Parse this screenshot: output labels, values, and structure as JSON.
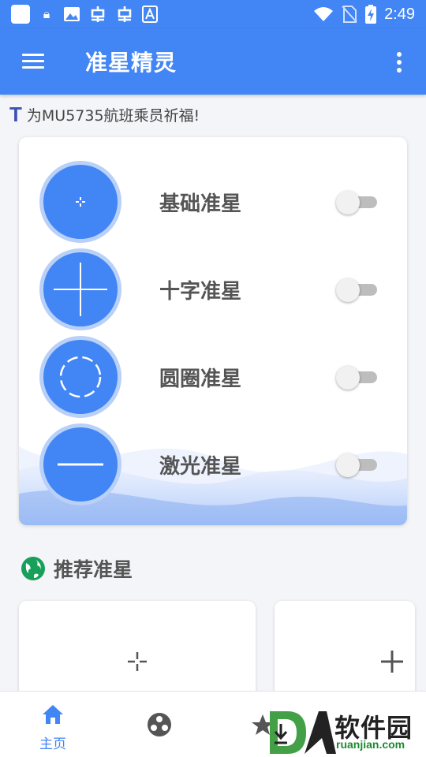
{
  "status_bar": {
    "time": "2:49",
    "left_icons": [
      "app-square-icon",
      "lock-icon",
      "image-icon",
      "bug-icon",
      "bug-icon",
      "font-icon"
    ],
    "right_icons": [
      "wifi-icon",
      "no-sim-icon",
      "battery-charging-icon"
    ]
  },
  "app_bar": {
    "title": "准星精灵"
  },
  "notice": {
    "text": "为MU5735航班乘员祈福!"
  },
  "crosshairs": [
    {
      "label": "基础准星",
      "icon": "small-crosshair-icon",
      "enabled": false
    },
    {
      "label": "十字准星",
      "icon": "cross-crosshair-icon",
      "enabled": false
    },
    {
      "label": "圆圈准星",
      "icon": "circle-crosshair-icon",
      "enabled": false
    },
    {
      "label": "激光准星",
      "icon": "laser-crosshair-icon",
      "enabled": false
    }
  ],
  "recommended": {
    "title": "推荐准星",
    "icon": "globe-icon"
  },
  "bottom_nav": {
    "items": [
      {
        "label": "主页",
        "icon": "home-icon",
        "active": true
      },
      {
        "label": "",
        "icon": "community-icon",
        "active": false
      },
      {
        "label": "",
        "icon": "star-icon",
        "active": false
      }
    ]
  },
  "watermark": {
    "brand": "软件园",
    "domain": "ruanjian.com"
  },
  "colors": {
    "primary": "#4285f4",
    "circle_ring": "#b9d0f7",
    "notice_icon": "#3f51b5",
    "globe": "#18a05a"
  }
}
